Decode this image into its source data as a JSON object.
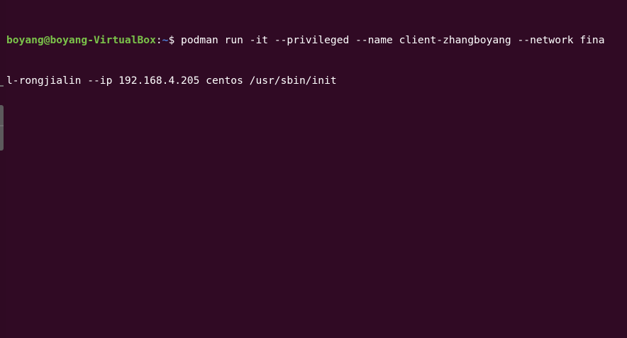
{
  "terminal": {
    "prompt": {
      "user_host": "boyang@boyang-VirtualBox",
      "separator": ":",
      "path": "~",
      "symbol": "$ "
    },
    "command_line_1": "podman run -it --privileged --name client-zhangboyang --network fina",
    "command_line_2": "l-rongjialin --ip 192.168.4.205 centos /usr/sbin/init"
  },
  "colors": {
    "background": "#300a24",
    "prompt_user": "#7bc34a",
    "prompt_path": "#4f7fd8",
    "text": "#ffffff"
  }
}
